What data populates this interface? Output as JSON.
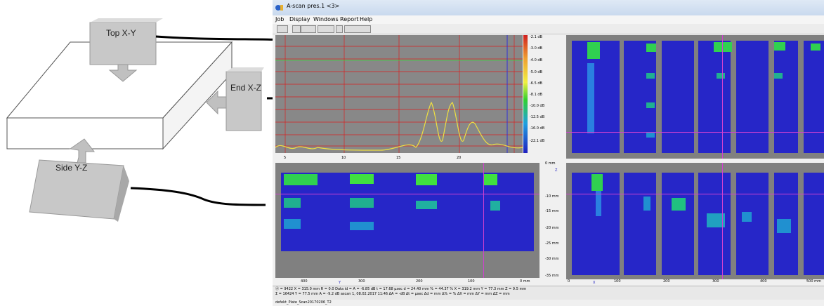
{
  "diagram": {
    "labels": {
      "top": "Top X-Y",
      "end": "End X-Z",
      "side": "Side Y-Z"
    }
  },
  "window": {
    "title": "A-scan pres.1 <3>",
    "icon": "app-icon"
  },
  "menu": [
    "Job",
    "Display",
    "Windows",
    "Report",
    "Help"
  ],
  "toolbar": {
    "buttons": [
      "view-toggle-icon",
      "nav-back-icon",
      "nav-fwd-icon",
      "grid-icon",
      "refresh-icon",
      "layout-icon"
    ]
  },
  "ascan": {
    "db_labels": [
      "-2.1 dB",
      "-3.0 dB",
      "-4.0 dB",
      "-5.0 dB",
      "-6.5 dB",
      "-8.1 dB",
      "-10.0 dB",
      "-12.5 dB",
      "-16.0 dB",
      "-22.1 dB"
    ],
    "x_ticks": [
      "5",
      "10",
      "15",
      "20"
    ]
  },
  "depth_scale": {
    "labels": [
      "0 mm",
      "",
      "-10 mm",
      "-15 mm",
      "-20 mm",
      "-25 mm",
      "-30 mm",
      "-35 mm"
    ],
    "axis_letter": "Z"
  },
  "bscan": {
    "x_ticks": [
      "400",
      "300",
      "200",
      "100",
      "0 mm"
    ],
    "axis_letter": "Y"
  },
  "cscan": {
    "x_ticks": [
      "0",
      "100",
      "200",
      "300",
      "400",
      "500 mm"
    ],
    "axis_letter": "X"
  },
  "status": {
    "line1": "Ⓐ = 9422   X = 315.0 mm   R = 0.0     Data id =          A = -6.85 dB   t = 17.68 µsec   d = 24.40 mm   % = 44.37 %   X = 319.2 mm   Y = 77.3 mm   Z = 9.5 mm",
    "line2": "Σ = 16424   Y = 77.5 mm   A = -9.2 dB   ascan 1, 08.02.2017 11:46   ΔA = -dB   Δt = µsec   Δd = mm   Δ% = %   ΔX = mm   ΔY = mm   ΔZ = mm",
    "file": "defekt_Plate_Scan20170206_T2"
  }
}
